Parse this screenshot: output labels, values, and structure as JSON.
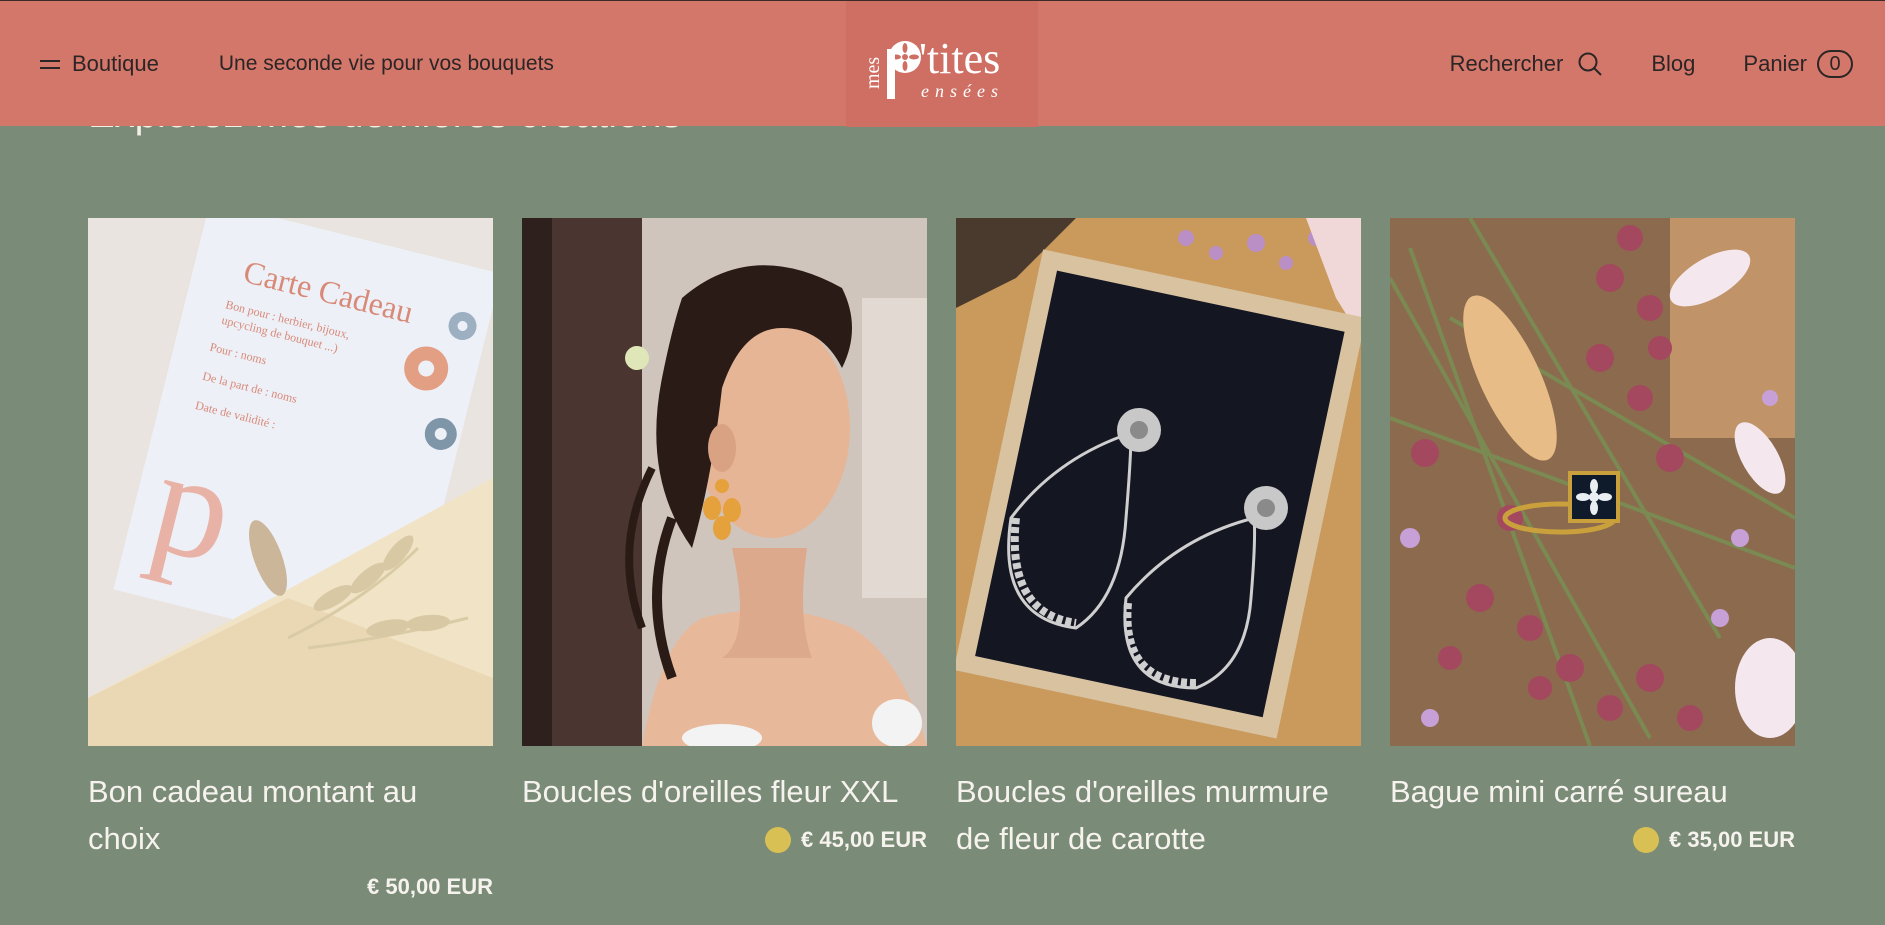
{
  "header": {
    "menu_label": "Boutique",
    "tagline": "Une seconde vie pour vos bouquets",
    "logo": {
      "word1": "mes",
      "word2": "p'tites",
      "word3": "ensées"
    },
    "search_label": "Rechercher",
    "blog_label": "Blog",
    "cart_label": "Panier",
    "cart_count": "0"
  },
  "section_title": "Explorez mes dernières créations",
  "products": [
    {
      "title": "Bon cadeau montant au choix",
      "price": "€ 50,00 EUR",
      "has_swatch": false,
      "image": "gift-card-photo"
    },
    {
      "title": "Boucles d'oreilles fleur XXL",
      "price": "€ 45,00 EUR",
      "has_swatch": true,
      "image": "model-earring-photo"
    },
    {
      "title": "Boucles d'oreilles murmure de fleur de carotte",
      "price": "",
      "has_swatch": false,
      "image": "hoop-earrings-photo"
    },
    {
      "title": "Bague mini carré sureau",
      "price": "€ 35,00 EUR",
      "has_swatch": true,
      "image": "ring-berries-photo"
    }
  ],
  "colors": {
    "header_bg": "#d3776b",
    "page_bg": "#7a8b78",
    "swatch": "#d8c055"
  },
  "image_texts": {
    "gift_card_title": "Carte Cadeau",
    "gift_card_line1": "Bon pour : herbier, bijoux,",
    "gift_card_line2": "upcycling de bouquet ...)",
    "gift_card_line3": "Pour : noms",
    "gift_card_line4": "De la part de : noms",
    "gift_card_line5": "Date de validité :"
  }
}
